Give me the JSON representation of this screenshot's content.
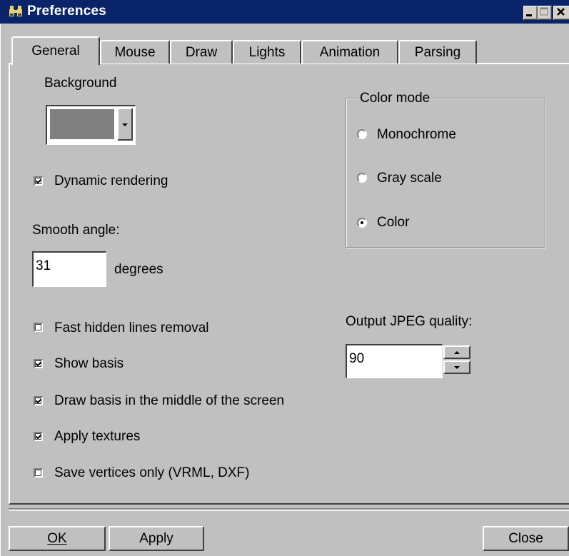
{
  "window": {
    "title": "Preferences",
    "icon": "binoculars-icon"
  },
  "tabs": [
    {
      "label": "General",
      "active": true
    },
    {
      "label": "Mouse",
      "active": false
    },
    {
      "label": "Draw",
      "active": false
    },
    {
      "label": "Lights",
      "active": false
    },
    {
      "label": "Animation",
      "active": false
    },
    {
      "label": "Parsing",
      "active": false
    }
  ],
  "general": {
    "background_label": "Background",
    "background_color": "#808080",
    "dynamic_rendering": {
      "label": "Dynamic rendering",
      "checked": true
    },
    "smooth_angle_label": "Smooth angle:",
    "smooth_angle_value": "31",
    "smooth_angle_unit": "degrees",
    "fast_hidden_lines": {
      "label": "Fast hidden lines removal",
      "checked": false
    },
    "show_basis": {
      "label": "Show basis",
      "checked": true
    },
    "draw_basis_middle": {
      "label": "Draw basis in the middle of the screen",
      "checked": true
    },
    "apply_textures": {
      "label": "Apply textures",
      "checked": true
    },
    "save_vertices_only": {
      "label": "Save vertices only (VRML, DXF)",
      "checked": false
    },
    "color_mode": {
      "title": "Color mode",
      "options": [
        {
          "label": "Monochrome",
          "selected": false
        },
        {
          "label": "Gray scale",
          "selected": false
        },
        {
          "label": "Color",
          "selected": true
        }
      ]
    },
    "jpeg_quality_label": "Output JPEG quality:",
    "jpeg_quality_value": "90"
  },
  "buttons": {
    "ok": "OK",
    "apply": "Apply",
    "close": "Close"
  }
}
